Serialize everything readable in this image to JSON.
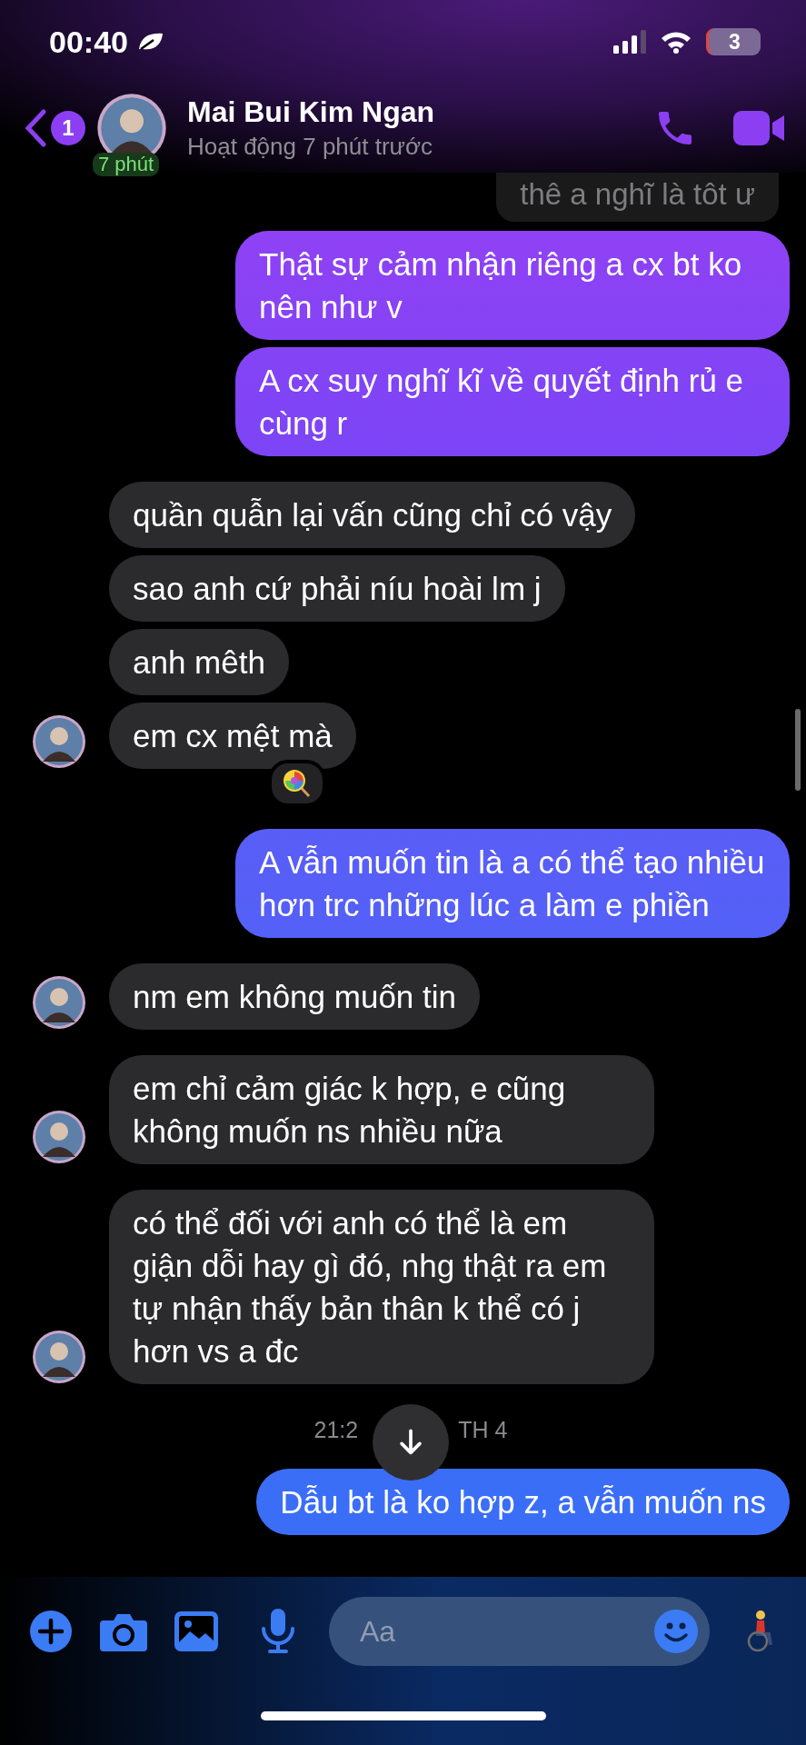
{
  "status_bar": {
    "time": "00:40",
    "battery": "3"
  },
  "header": {
    "back_badge": "1",
    "avatar_caption": "7 phút",
    "name": "Mai Bui Kim Ngan",
    "subtitle": "Hoạt động 7 phút trước"
  },
  "messages": [
    {
      "kind": "faded",
      "text": "thê a nghĩ là tôt ư"
    },
    {
      "kind": "outgoing",
      "text": "Thật sự cảm nhận riêng a cx bt ko nên như v"
    },
    {
      "kind": "outgoing",
      "text": "A cx suy nghĩ kĩ về quyết định rủ e cùng r"
    },
    {
      "kind": "incoming",
      "text": "quần quẫn lại vấn cũng chỉ có vậy",
      "avatar": false,
      "reacted": false
    },
    {
      "kind": "incoming",
      "text": "sao anh cứ phải níu hoài lm j",
      "avatar": false,
      "reacted": false
    },
    {
      "kind": "incoming",
      "text": "anh mêth",
      "avatar": false,
      "reacted": false
    },
    {
      "kind": "incoming",
      "text": "em cx mệt mà",
      "avatar": true,
      "reacted": true
    },
    {
      "kind": "outgoing",
      "text": "A vẫn muốn tin là a có thể tạo nhiều hơn trc những lúc a làm e phiền"
    },
    {
      "kind": "incoming",
      "text": "nm em không muốn tin",
      "avatar": true,
      "reacted": false
    },
    {
      "kind": "incoming",
      "text": "em chỉ cảm giác k hợp, e cũng không muốn ns nhiều nữa",
      "avatar": true,
      "reacted": false
    },
    {
      "kind": "incoming",
      "text": "có thể đối với anh có thể là em giận dỗi hay gì đó, nhg thật ra em tự nhận thấy bản thân k thể có j hơn vs a đc",
      "avatar": true,
      "reacted": false
    },
    {
      "kind": "timestamp",
      "left": "21:2",
      "right": "TH 4"
    },
    {
      "kind": "outgoing",
      "text": "Dẫu bt là ko hợp z, a vẫn muốn ns"
    }
  ],
  "composer": {
    "placeholder": "Aa"
  }
}
